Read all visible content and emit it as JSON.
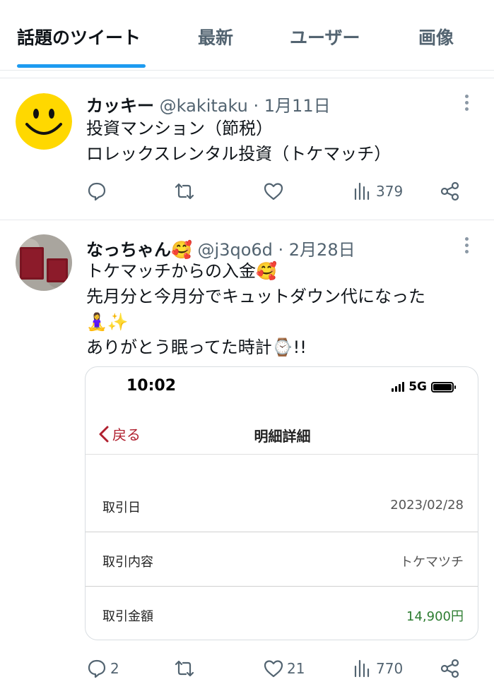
{
  "tabs": [
    {
      "label": "話題のツイート",
      "active": true
    },
    {
      "label": "最新",
      "active": false
    },
    {
      "label": "ユーザー",
      "active": false
    },
    {
      "label": "画像",
      "active": false
    }
  ],
  "tweets": [
    {
      "name": "カッキー",
      "handle": "@kakitaku",
      "date": "· 1月11日",
      "text": "投資マンション（節税）\nロレックスレンタル投資（トケマッチ）",
      "actions": {
        "reply": "",
        "retweet": "",
        "like": "",
        "views": "379"
      }
    },
    {
      "name": "なっちゃん🥰",
      "handle": "@j3qo6d",
      "date": "· 2月28日",
      "text": "トケマッチからの入金🥰\n先月分と今月分でキュットダウン代になった\n🧘‍♀️✨\nありがとう眠ってた時計⌚!!",
      "actions": {
        "reply": "2",
        "retweet": "",
        "like": "21",
        "views": "770"
      }
    }
  ],
  "card": {
    "time": "10:02",
    "network": "5G",
    "back_label": "戻る",
    "title": "明細詳細",
    "rows": [
      {
        "label": "取引日",
        "value": "2023/02/28"
      },
      {
        "label": "取引内容",
        "value": "トケマツチ"
      },
      {
        "label": "取引金額",
        "value": "14,900円"
      }
    ]
  },
  "colors": {
    "accent": "#1d9bf0",
    "back_red": "#b0202f",
    "amount_green": "#2e7d32",
    "muted": "#536471"
  },
  "icons": [
    "reply-icon",
    "retweet-icon",
    "like-icon",
    "views-icon",
    "share-icon",
    "more-icon",
    "chevron-left-icon"
  ]
}
